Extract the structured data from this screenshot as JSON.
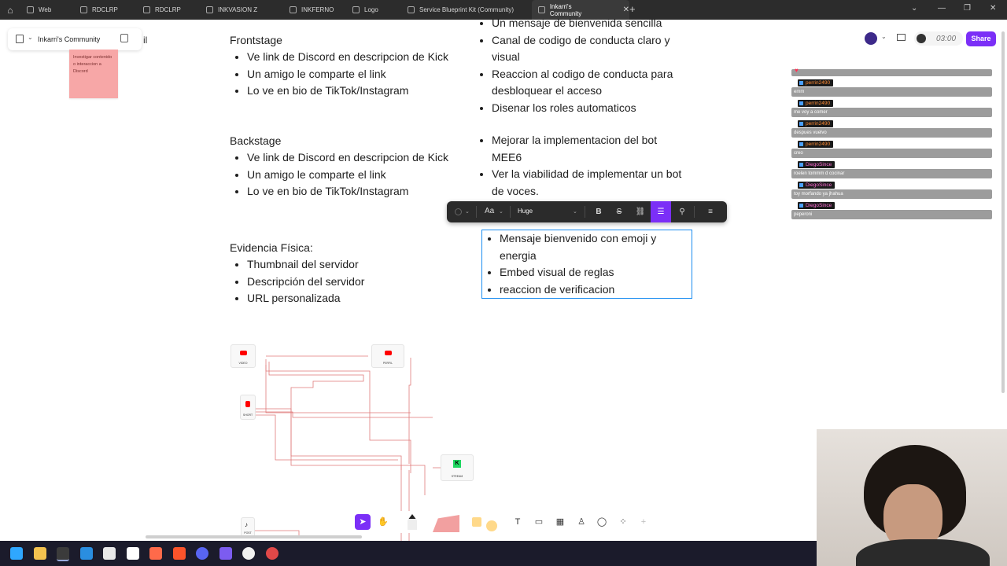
{
  "tabs": [
    {
      "label": "Web",
      "active": false
    },
    {
      "label": "RDCLRP",
      "active": false
    },
    {
      "label": "RDCLRP",
      "active": false
    },
    {
      "label": "INKVASION Z",
      "active": false
    },
    {
      "label": "INKFERNO",
      "active": false
    },
    {
      "label": "Logo",
      "active": false
    },
    {
      "label": "Service Blueprint Kit (Community)",
      "active": false
    },
    {
      "label": "Inkarri's Community",
      "active": true
    }
  ],
  "file": {
    "name": "Inkarri's Community",
    "trailing": "il"
  },
  "sticky_note": {
    "text": "Investigar contenido o interaccion a Discord",
    "color": "#f7a7a7"
  },
  "top_right": {
    "timer": "03:00",
    "share_label": "Share",
    "accent": "#7b2ff7"
  },
  "frontstage": {
    "title": "Frontstage",
    "left_items": [
      "Ve link de Discord en descripcion de Kick",
      "Un amigo le comparte el link",
      "Lo ve en bio de TikTok/Instagram"
    ],
    "right_items": [
      "Un mensaje de bienvenida sencilla",
      "Canal de codigo de conducta claro y visual",
      "Reaccion al codigo de conducta para desbloquear el acceso",
      "Disenar los roles automaticos"
    ]
  },
  "backstage": {
    "title": "Backstage",
    "left_items": [
      "Ve link de Discord en descripcion de Kick",
      "Un amigo le comparte el link",
      "Lo ve en bio de TikTok/Instagram"
    ],
    "right_items": [
      "Mejorar la implementacion del bot MEE6",
      "Ver la viabilidad de implementar un bot de voces."
    ]
  },
  "evidencia": {
    "title": "Evidencia Física:",
    "left_items": [
      "Thumbnail del servidor",
      "Descripción del servidor",
      "URL personalizada"
    ],
    "right_items": [
      "Mensaje bienvenido con emoji y energia",
      "Embed visual de reglas",
      "reaccion de verificacion"
    ]
  },
  "format_toolbar": {
    "font_label": "Aa",
    "size_label": "Huge"
  },
  "chat": [
    {
      "user": "perrin2490",
      "message": "emm",
      "color": "#ff8a33"
    },
    {
      "user": "perrin2490",
      "message": "me voy a comer",
      "color": "#ff8a33"
    },
    {
      "user": "perrin2490",
      "message": "despues vuelvo",
      "color": "#ff8a33"
    },
    {
      "user": "perrin2490",
      "message": "creo",
      "color": "#ff8a33"
    },
    {
      "user": "DiegoSince",
      "message": "roelen tommm d cocinar",
      "color": "#ff6ad5"
    },
    {
      "user": "DiegoSince",
      "message": "toy morfando ya jhahua",
      "color": "#ff6ad5"
    },
    {
      "user": "DiegoSince",
      "message": "peperoni",
      "color": "#ff6ad5"
    }
  ],
  "flow_nodes": [
    {
      "label": "VIDEO",
      "kind": "youtube"
    },
    {
      "label": "PERFIL",
      "kind": "youtube"
    },
    {
      "label": "SHORT",
      "kind": "youtube-short"
    },
    {
      "label": "STREAM",
      "kind": "kick"
    },
    {
      "label": "POST",
      "kind": "tiktok"
    }
  ]
}
